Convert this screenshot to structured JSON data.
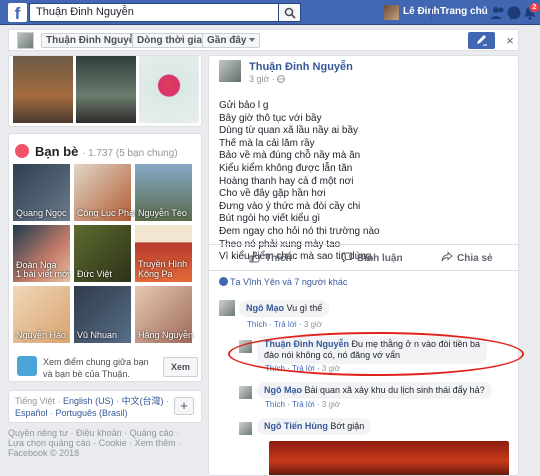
{
  "topbar": {
    "logo": "f",
    "search_value": "Thuận Đinh Nguyễn",
    "user_name": "Lê Đinh",
    "home_label": "Trang chủ",
    "notification_count": "2"
  },
  "subbar": {
    "name_button": "Thuận Đinh Nguyễn",
    "timeline_button": "Dòng thời gian",
    "recent_button": "Gần đây",
    "close": "×"
  },
  "friends": {
    "title": "Bạn bè",
    "count": "· 1.737 (5 bạn chung)",
    "tiles": [
      {
        "name": "Quang Ngọc",
        "color": "#3b4a5a"
      },
      {
        "name": "Công Lục Phan",
        "color": "#b25c32"
      },
      {
        "name": "Nguyễn Tèo",
        "color": "#87a9c6"
      },
      {
        "name": "Đoàn Nga",
        "color": "#c47b69"
      },
      {
        "name": "Đức Việt",
        "color": "#5e6b2f"
      },
      {
        "name": "Truyền Hình Kông Pa",
        "color": "#b83a2e"
      },
      {
        "name": "Nguyễn Hảo",
        "color": "#d9a36f"
      },
      {
        "name": "Vũ Nhuan",
        "color": "#576d88"
      },
      {
        "name": "Hằng Nguyễn",
        "color": "#9e6a5b"
      }
    ],
    "tile_overlay_1": "1 bài viết mới",
    "suggest_text": "Xem điểm chung giữa bạn và bạn bè của Thuận.",
    "see_button": "Xem"
  },
  "languages": {
    "line1_plain": "Tiếng Việt ·",
    "english": "English (US)",
    "chinese": "中文(台灣)",
    "spanish": "Español",
    "portuguese": "Português (Brasil)",
    "plus": "+"
  },
  "footer": {
    "line1": "Quyền riêng tư · Điều khoản · Quảng cáo ·",
    "line2": "Lựa chọn quảng cáo · Cookie · Xem thêm ·",
    "line3": "Facebook © 2018"
  },
  "post": {
    "author": "Thuận Đinh Nguyễn",
    "time": "3 giờ ·",
    "lines": [
      "Gửi bảo l         g",
      "Bây giờ thô tục với bầy",
      "Dùng từ quan xã lầu nầy ai bầy",
      "Thế mà la cải lăm rầy",
      "Bảo về mà đúng chỗ nầy mà ăn",
      "Kiểu kiểm không được lẫn tăn",
      "Hoàng thanh hay cả đ          một nơi",
      "Cho về đây gặp hần hơi",
      "Đưng vào ý thức mà đòi cầy chi",
      "Bút ngòi họ viết kiểu gì",
      "Đem ngay cho hỏi nó thi trường nào",
      "Theo nó phải xung mày tao",
      "Vì kiểu kiểm chác mà sao tin dùng."
    ],
    "like": "Thích",
    "comment": "Bình luận",
    "share": "Chia sẻ",
    "reactions": "Tạ Vĩnh Yên và 7 người khác"
  },
  "comments": [
    {
      "name": "Ngô Mạo",
      "text": "Vu gì thế",
      "meta_like": "Thích",
      "meta_reply": "Trả lời",
      "meta_time": "3 giờ"
    },
    {
      "name": "Thuận Đình Nguyễn",
      "text1": "Đu mẹ thằng ở          n vào đòi tiền ba",
      "text2": "đào nói không có, nó đăng vớ vẩn",
      "meta_like": "Thích",
      "meta_reply": "Trả lời",
      "meta_time": "3 giờ"
    },
    {
      "name": "Ngô Mạo",
      "text": "Bài quan xã xảy khu du lịch sinh thái đẩy hả?",
      "meta_like": "Thích",
      "meta_reply": "Trả lời",
      "meta_time": "3 giờ"
    },
    {
      "name": "Ngô Tiến Hùng",
      "text": "Bớt giận"
    }
  ]
}
